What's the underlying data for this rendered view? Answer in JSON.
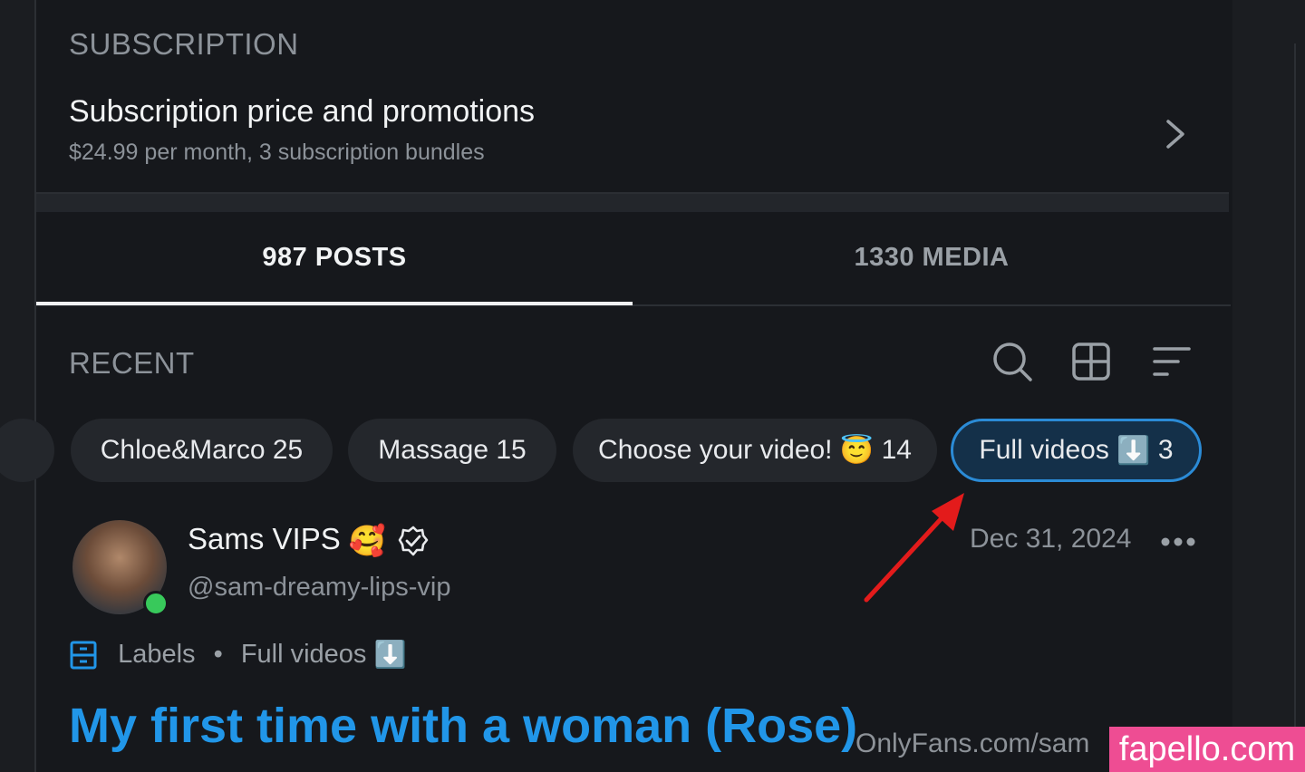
{
  "subscription": {
    "section_title": "SUBSCRIPTION",
    "title": "Subscription price and promotions",
    "subtitle": "$24.99 per month, 3 subscription bundles"
  },
  "tabs": [
    {
      "label": "987 POSTS",
      "active": true
    },
    {
      "label": "1330 MEDIA",
      "active": false
    }
  ],
  "feed": {
    "section_title": "RECENT",
    "tools": [
      "search-icon",
      "grid-icon",
      "sort-icon"
    ]
  },
  "chips": [
    {
      "label": "Chloe&Marco 25"
    },
    {
      "label": "Massage 15"
    },
    {
      "label": "Choose your video!",
      "emoji": "😇",
      "count": "14"
    },
    {
      "label": "Full videos",
      "emoji": "⬇️",
      "count": "3",
      "active": true
    }
  ],
  "post": {
    "author_name": "Sams VIPS",
    "author_emoji": "🥰",
    "handle": "@sam-dreamy-lips-vip",
    "date": "Dec 31, 2024",
    "labels_text": "Labels",
    "label_sep": "•",
    "label_value": "Full videos",
    "label_emoji": "⬇️",
    "title": "My first time with a woman (Rose)"
  },
  "watermark": {
    "text": "OnlyFans.com/sam",
    "brand": "fapello.com"
  },
  "colors": {
    "accent": "#2196e8",
    "active_chip_bg": "#143049",
    "online": "#38c95b",
    "arrow": "#e31b1b",
    "brand": "#ee4d93"
  }
}
